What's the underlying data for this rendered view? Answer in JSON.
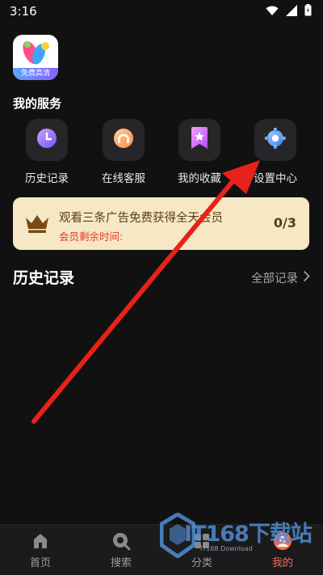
{
  "status_bar": {
    "time": "3:16"
  },
  "app_logo": {
    "badge": "免费高清"
  },
  "services": {
    "title": "我的服务",
    "items": [
      {
        "label": "历史记录",
        "icon": "clock-icon"
      },
      {
        "label": "在线客服",
        "icon": "headset-icon"
      },
      {
        "label": "我的收藏",
        "icon": "bookmark-star-icon"
      },
      {
        "label": "设置中心",
        "icon": "gear-icon"
      }
    ]
  },
  "vip_banner": {
    "title": "观看三条广告免费获得全天会员",
    "subtitle": "会员剩余时间:",
    "progress": "0/3"
  },
  "history": {
    "title": "历史记录",
    "view_all": "全部记录"
  },
  "bottom_nav": {
    "items": [
      {
        "label": "首页",
        "icon": "home-icon"
      },
      {
        "label": "搜索",
        "icon": "search-icon"
      },
      {
        "label": "分类",
        "icon": "category-icon"
      },
      {
        "label": "我的",
        "icon": "profile-icon"
      }
    ],
    "active_index": 3
  },
  "watermark": {
    "text": "IT168下载站",
    "sub": "IT168 Download"
  },
  "colors": {
    "background": "#111112",
    "banner": "#f6e7c5",
    "accent_red": "#e53a2a",
    "nav_active": "#ff6a4d",
    "arrow": "#e8211b"
  }
}
